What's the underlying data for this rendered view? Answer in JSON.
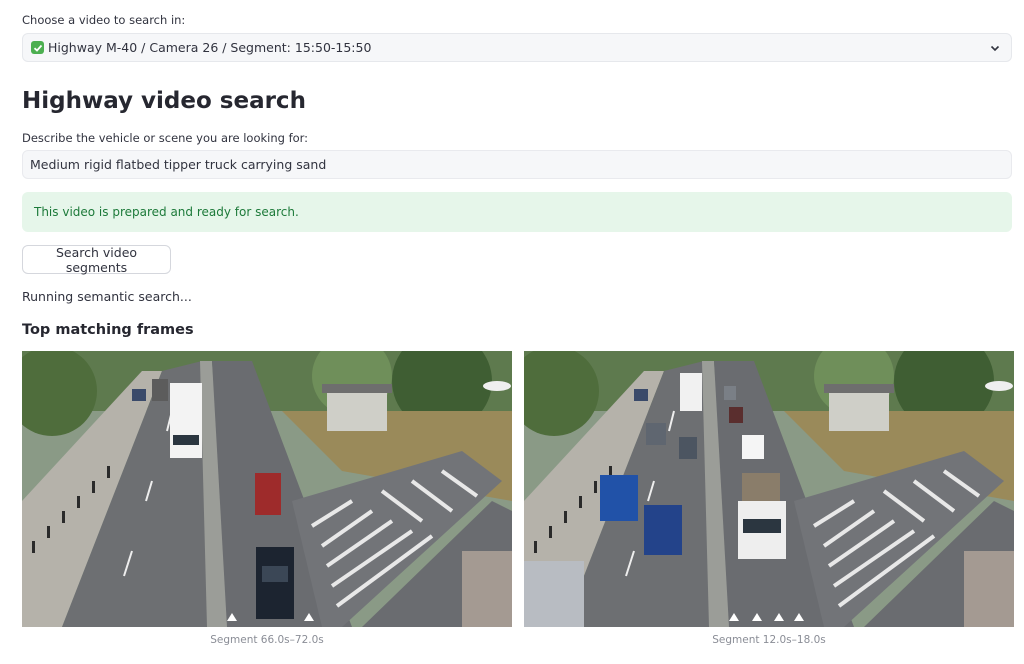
{
  "selector": {
    "label": "Choose a video to search in:",
    "selected": "Highway M-40 / Camera 26 / Segment: 15:50-15:50",
    "selected_icon": "check-icon"
  },
  "page": {
    "title": "Highway video search"
  },
  "query": {
    "label": "Describe the vehicle or scene you are looking for:",
    "value": "Medium rigid flatbed tipper truck carrying sand"
  },
  "alert": {
    "text": "This video is prepared and ready for search."
  },
  "actions": {
    "search_label": "Search video segments"
  },
  "status": {
    "text": "Running semantic search..."
  },
  "results": {
    "heading": "Top matching frames",
    "frames": [
      {
        "caption": "Segment 66.0s–72.0s"
      },
      {
        "caption": "Segment 12.0s–18.0s"
      }
    ]
  },
  "colors": {
    "accent_green": "#4caf50",
    "alert_bg": "#e6f6ea",
    "alert_text": "#1d7a3a"
  }
}
